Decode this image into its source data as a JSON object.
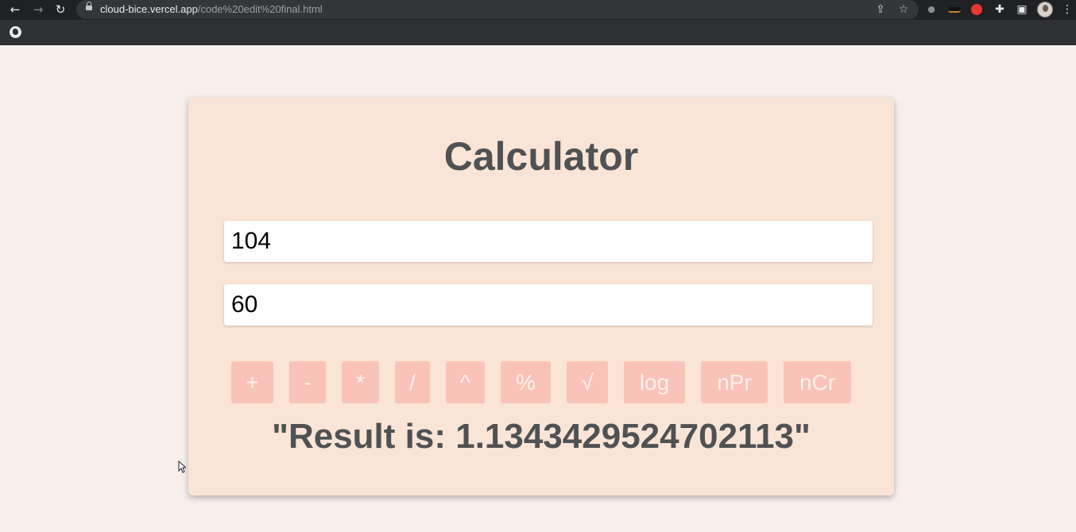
{
  "browser": {
    "url_host": "cloud-bice.vercel.app",
    "url_path": "/code%20edit%20final.html",
    "icons": {
      "back": "back-arrow-icon",
      "forward": "forward-arrow-icon",
      "reload": "reload-icon",
      "lock": "lock-icon",
      "share": "share-icon",
      "bookmark": "star-icon",
      "extensions": "puzzle-icon",
      "side_panel": "side-panel-icon",
      "menu": "kebab-menu-icon",
      "bookmark_favicon": "globe-icon"
    }
  },
  "calculator": {
    "title": "Calculator",
    "input1_value": "104",
    "input2_value": "60",
    "operations": [
      "+",
      "-",
      "*",
      "/",
      "^",
      "%",
      "√",
      "log",
      "nPr",
      "nCr"
    ],
    "result_text": "\"Result is: 1.1343429524702113\""
  },
  "colors": {
    "page_bg": "#f8efed",
    "card_bg": "#f9e4d6",
    "button_bg": "#fac3b9",
    "button_text": "#fdf1ec",
    "heading_text": "#4f5152"
  }
}
